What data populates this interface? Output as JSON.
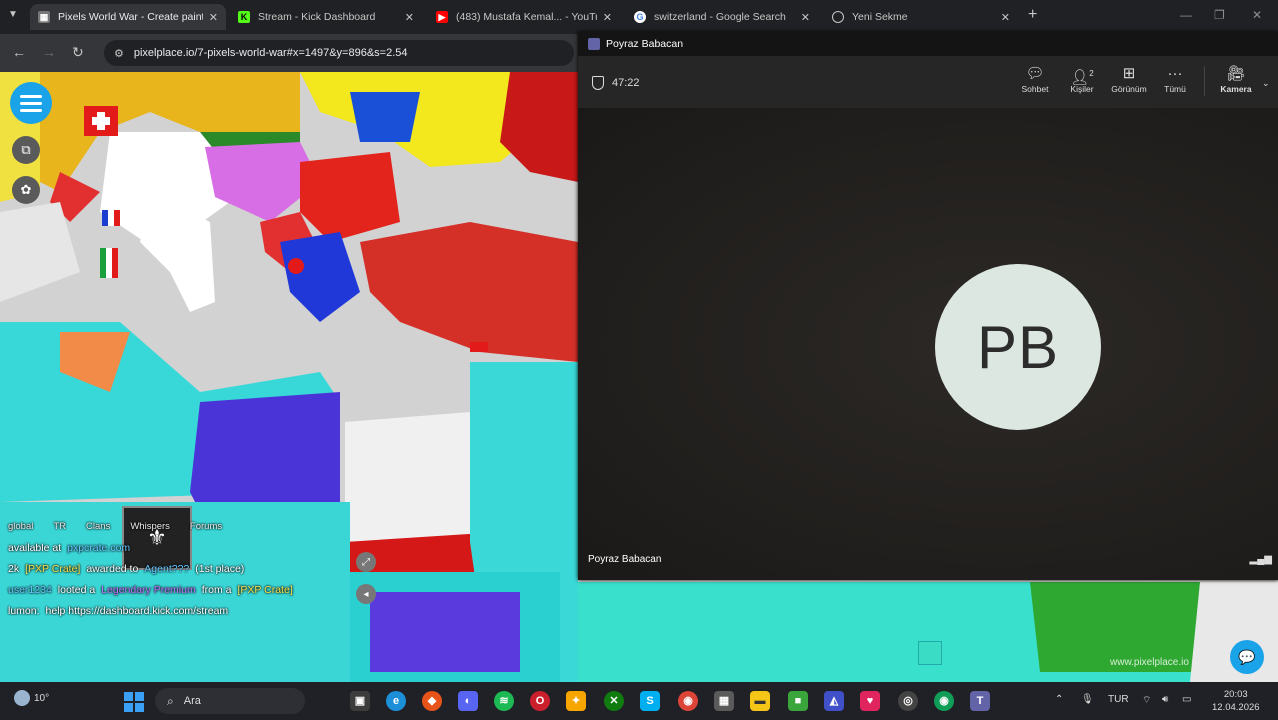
{
  "browser": {
    "tabs": [
      {
        "title": "Pixels World War - Create paint",
        "active": true
      },
      {
        "title": "Stream - Kick Dashboard"
      },
      {
        "title": "(483) Mustafa Kemal... - YouTube"
      },
      {
        "title": "switzerland - Google Search"
      },
      {
        "title": "Yeni Sekme"
      }
    ],
    "url": "pixelplace.io/7-pixels-world-war#x=1497&y=896&s=2.54"
  },
  "stream_overlay": {
    "tabs": [
      "global",
      "TR",
      "Clans",
      "Whispers",
      "Forums"
    ],
    "line1_prefix": "available at",
    "line1_link": "pxpcrate.com",
    "line2_amount": "2k",
    "line2_item": "[PXP Crate]",
    "line2_mid": "awarded to",
    "line2_user": "Agent???",
    "line2_place": "(1st place)",
    "line3_user": "user1234",
    "line3_mid": "looted a",
    "line3_item": "Legendary Premium",
    "line3_from": "from a",
    "line3_crate": "[PXP Crate]",
    "line4_user": "lumon:",
    "line4_text": "help https://dashboard.kick.com/stream",
    "watermark": "www.pixelplace.io"
  },
  "call": {
    "window_title": "Poyraz Babacan",
    "timer": "47:22",
    "controls": [
      {
        "label": "Sohbet",
        "icon": "chat-icon"
      },
      {
        "label": "Kişiler",
        "icon": "people-icon",
        "count": "2"
      },
      {
        "label": "Görünüm",
        "icon": "grid-icon"
      },
      {
        "label": "Tümü",
        "icon": "more-icon"
      },
      {
        "label": "Kamera",
        "icon": "camera-off-icon"
      }
    ],
    "avatar_initials": "PB",
    "participant_name": "Poyraz Babacan"
  },
  "taskbar": {
    "temperature": "10°",
    "search_placeholder": "Ara",
    "language": "TUR",
    "time": "20:03",
    "date": "12.04.2026"
  }
}
